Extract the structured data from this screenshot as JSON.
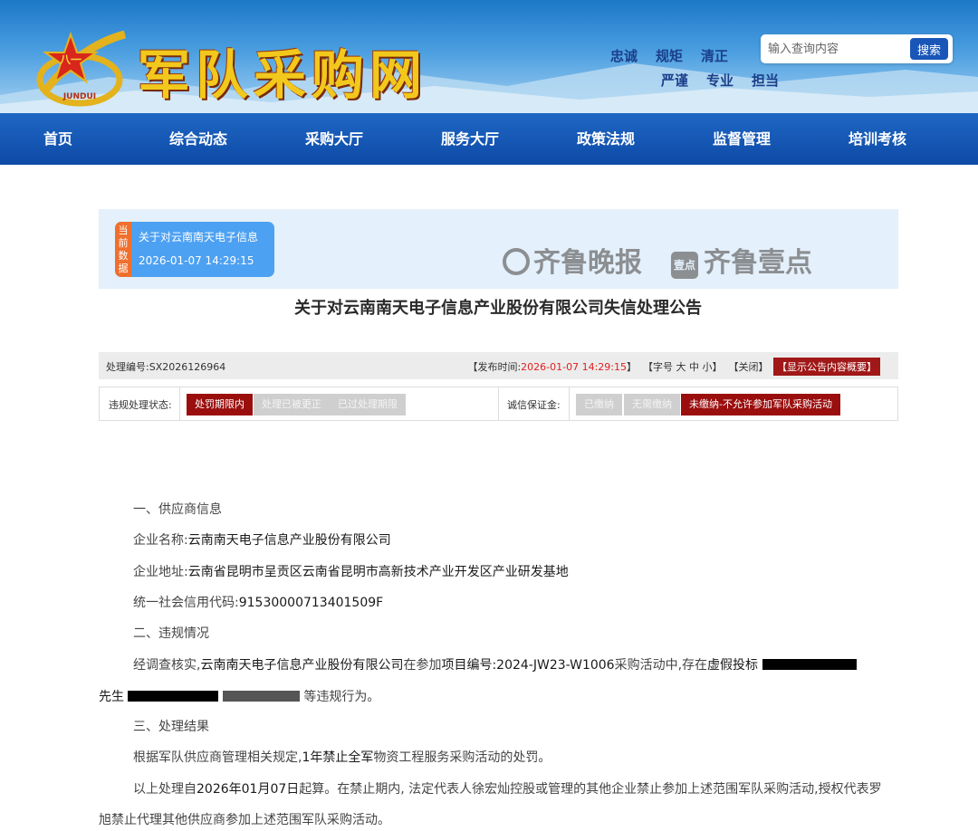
{
  "header": {
    "site_name": "军队采购网",
    "emblem_text": "八一",
    "emblem_subtext": "JUNDUI",
    "motto_row1": [
      "忠诚",
      "规矩",
      "清正"
    ],
    "motto_row2": [
      "严谨",
      "专业",
      "担当"
    ],
    "search_placeholder": "输入查询内容",
    "search_button": "搜索"
  },
  "nav": [
    "首页",
    "综合动态",
    "采购大厅",
    "服务大厅",
    "政策法规",
    "监督管理",
    "培训考核"
  ],
  "current": {
    "side_label": "当前数据",
    "title": "关于对云南南天电子信息",
    "time": "2026-01-07 14:29:15"
  },
  "watermark": {
    "left": "齐鲁晚报",
    "square": "壹点",
    "right": "齐鲁壹点"
  },
  "article": {
    "title": "关于对云南南天电子信息产业股份有限公司失信处理公告",
    "code_label": "处理编号:",
    "code": "SX2026126964",
    "publish_label": "【发布时间:",
    "publish_time": "2026-01-07 14:29:15",
    "publish_close": "】",
    "font_label": "【字号",
    "font_large": "大",
    "font_mid": "中",
    "font_small": "小",
    "font_close": "】",
    "close_label": "【关闭】",
    "summary_button": "【显示公告内容概要】"
  },
  "status": {
    "violation_label": "违规处理状态:",
    "violation_options": [
      "处罚期限内",
      "处理已被更正",
      "已过处理期限"
    ],
    "deposit_label": "诚信保证金:",
    "deposit_options": [
      "已缴纳",
      "无需缴纳",
      "未缴纳-不允许参加军队采购活动"
    ]
  },
  "content": {
    "s1": "一、供应商信息",
    "name_label": "企业名称:",
    "name": "云南南天电子信息产业股份有限公司",
    "addr_label": "企业地址:",
    "addr": "云南省昆明市呈贡区云南省昆明市高新技术产业开发区产业研发基地",
    "code_label": "统一社会信用代码:",
    "code": "91530000713401509F",
    "s2": "二、违规情况",
    "p1a": "经调查核实,",
    "p1b": "云南南天电子信息产业股份有限公司",
    "p1c": "在参加",
    "p1d": "项目编号:2024-JW23-W1006",
    "p1e": "采购活动中,存在",
    "p1f": "虚假投标",
    "p2a": "先生",
    "p2b": "等违规行为。",
    "s3": "三、处理结果",
    "p3a": "根据军队供应商管理相关规定,",
    "p3b": "1年禁止全军",
    "p3c": "物资工程服务采购活动的处罚。",
    "p4a": "以上处理自",
    "p4b": "2026年01月07日",
    "p4c": "起算。在禁止期内, 法定代表人徐宏灿控股或管理的其他企业禁止参加上述范围军队采购活动,授权代表罗",
    "p5": "旭禁止代理其他供应商参加上述范围军队采购活动。"
  }
}
